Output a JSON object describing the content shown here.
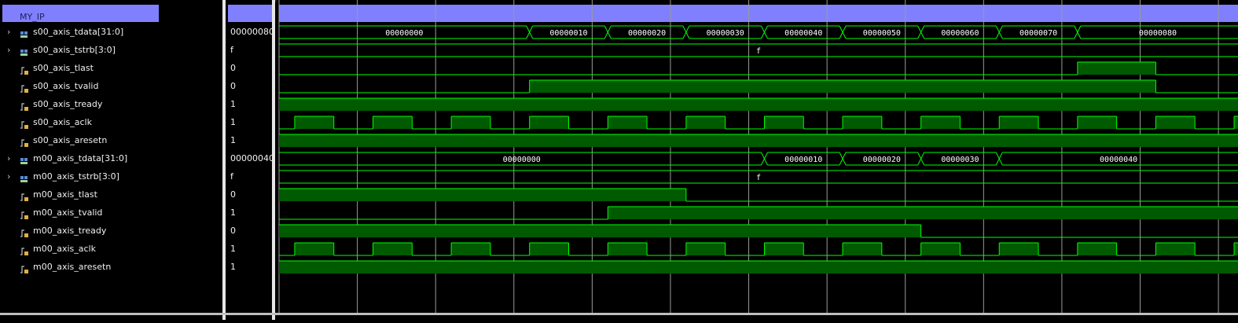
{
  "group": {
    "label": "MY_IP"
  },
  "signals": [
    {
      "name": "s00_axis_tdata[31:0]",
      "value": "00000080",
      "kind": "bus",
      "icon": "bus-icon"
    },
    {
      "name": "s00_axis_tstrb[3:0]",
      "value": "f",
      "kind": "bus",
      "icon": "bus-icon"
    },
    {
      "name": "s00_axis_tlast",
      "value": "0",
      "kind": "bit",
      "icon": "bit-icon"
    },
    {
      "name": "s00_axis_tvalid",
      "value": "0",
      "kind": "bit",
      "icon": "bit-icon"
    },
    {
      "name": "s00_axis_tready",
      "value": "1",
      "kind": "bit",
      "icon": "bit-icon"
    },
    {
      "name": "s00_axis_aclk",
      "value": "1",
      "kind": "bit",
      "icon": "bit-icon"
    },
    {
      "name": "s00_axis_aresetn",
      "value": "1",
      "kind": "bit",
      "icon": "bit-icon"
    },
    {
      "name": "m00_axis_tdata[31:0]",
      "value": "00000040",
      "kind": "bus",
      "icon": "bus-icon"
    },
    {
      "name": "m00_axis_tstrb[3:0]",
      "value": "f",
      "kind": "bus",
      "icon": "bus-icon"
    },
    {
      "name": "m00_axis_tlast",
      "value": "0",
      "kind": "bit",
      "icon": "bit-icon"
    },
    {
      "name": "m00_axis_tvalid",
      "value": "1",
      "kind": "bit",
      "icon": "bit-icon"
    },
    {
      "name": "m00_axis_tready",
      "value": "0",
      "kind": "bit",
      "icon": "bit-icon"
    },
    {
      "name": "m00_axis_aclk",
      "value": "1",
      "kind": "bit",
      "icon": "bit-icon"
    },
    {
      "name": "m00_axis_aresetn",
      "value": "1",
      "kind": "bit",
      "icon": "bit-icon"
    }
  ],
  "time": {
    "start": 0,
    "end": 24.5,
    "period": 2,
    "grid_every": 2
  },
  "waves": {
    "s00_axis_tdata": [
      {
        "t": 0,
        "v": "00000000"
      },
      {
        "t": 6.4,
        "v": "00000010"
      },
      {
        "t": 8.4,
        "v": "00000020"
      },
      {
        "t": 10.4,
        "v": "00000030"
      },
      {
        "t": 12.4,
        "v": "00000040"
      },
      {
        "t": 14.4,
        "v": "00000050"
      },
      {
        "t": 16.4,
        "v": "00000060"
      },
      {
        "t": 18.4,
        "v": "00000070"
      },
      {
        "t": 20.4,
        "v": "00000080"
      }
    ],
    "s00_axis_tstrb": [
      {
        "t": 0,
        "v": "f"
      }
    ],
    "s00_axis_tlast": [
      {
        "t": 0,
        "v": 0
      },
      {
        "t": 20.4,
        "v": 1
      },
      {
        "t": 22.4,
        "v": 0
      }
    ],
    "s00_axis_tvalid": [
      {
        "t": 0,
        "v": 0
      },
      {
        "t": 6.4,
        "v": 1
      },
      {
        "t": 22.4,
        "v": 0
      }
    ],
    "s00_axis_tready": [
      {
        "t": 0,
        "v": 1
      }
    ],
    "s00_axis_aclk": {
      "clock": true,
      "first_rise": 0.4,
      "period": 2
    },
    "s00_axis_aresetn": [
      {
        "t": 0,
        "v": 1
      }
    ],
    "m00_axis_tdata": [
      {
        "t": 0,
        "v": "00000000"
      },
      {
        "t": 12.4,
        "v": "00000010"
      },
      {
        "t": 14.4,
        "v": "00000020"
      },
      {
        "t": 16.4,
        "v": "00000030"
      },
      {
        "t": 18.4,
        "v": "00000040"
      }
    ],
    "m00_axis_tstrb": [
      {
        "t": 0,
        "v": "f"
      }
    ],
    "m00_axis_tlast": [
      {
        "t": 0,
        "v": 1
      },
      {
        "t": 10.4,
        "v": 0
      }
    ],
    "m00_axis_tvalid": [
      {
        "t": 0,
        "v": 0
      },
      {
        "t": 8.4,
        "v": 1
      }
    ],
    "m00_axis_tready": [
      {
        "t": 0,
        "v": 1
      },
      {
        "t": 16.4,
        "v": 0
      }
    ],
    "m00_axis_aclk": {
      "clock": true,
      "first_rise": 0.4,
      "period": 2
    },
    "m00_axis_aresetn": [
      {
        "t": 0,
        "v": 1
      }
    ]
  },
  "wave_order": [
    "s00_axis_tdata",
    "s00_axis_tstrb",
    "s00_axis_tlast",
    "s00_axis_tvalid",
    "s00_axis_tready",
    "s00_axis_aclk",
    "s00_axis_aresetn",
    "m00_axis_tdata",
    "m00_axis_tstrb",
    "m00_axis_tlast",
    "m00_axis_tvalid",
    "m00_axis_tready",
    "m00_axis_aclk",
    "m00_axis_aresetn"
  ],
  "colors": {
    "wave": "#00ff00",
    "wave_fill": "#005a00",
    "group": "#8080ff",
    "grid": "#9a9a9a",
    "bus_text": "#ffffff"
  }
}
